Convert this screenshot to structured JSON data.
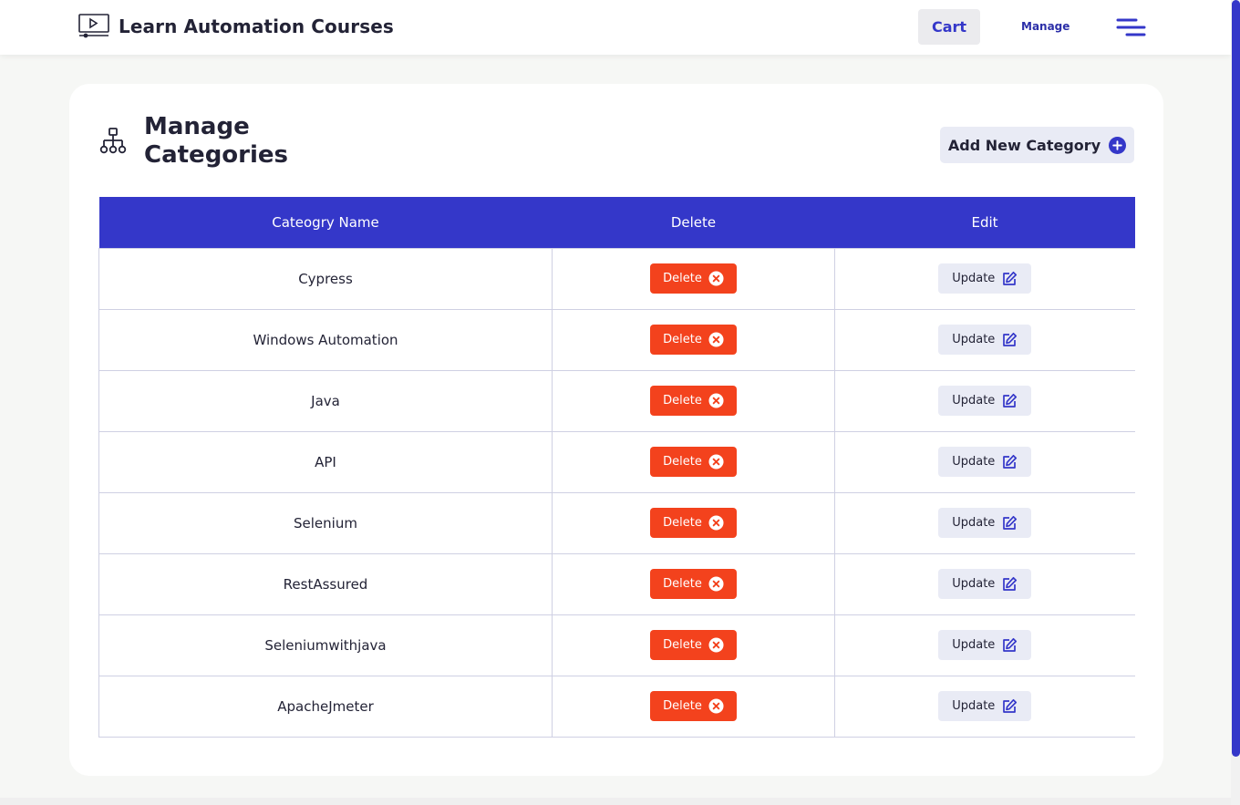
{
  "header": {
    "brand_title": "Learn Automation Courses",
    "cart_label": "Cart",
    "manage_label": "Manage"
  },
  "page": {
    "title": "Manage Categories",
    "add_button_label": "Add New Category"
  },
  "table": {
    "headers": [
      "Cateogry Name",
      "Delete",
      "Edit"
    ],
    "delete_label": "Delete",
    "update_label": "Update",
    "rows": [
      {
        "name": "Cypress"
      },
      {
        "name": "Windows Automation"
      },
      {
        "name": "Java"
      },
      {
        "name": "API"
      },
      {
        "name": "Selenium"
      },
      {
        "name": "RestAssured"
      },
      {
        "name": "Seleniumwithjava"
      },
      {
        "name": "ApacheJmeter"
      }
    ]
  },
  "colors": {
    "accent": "#3437c9",
    "delete": "#f3421d",
    "update_bg": "#e9ebf5"
  }
}
